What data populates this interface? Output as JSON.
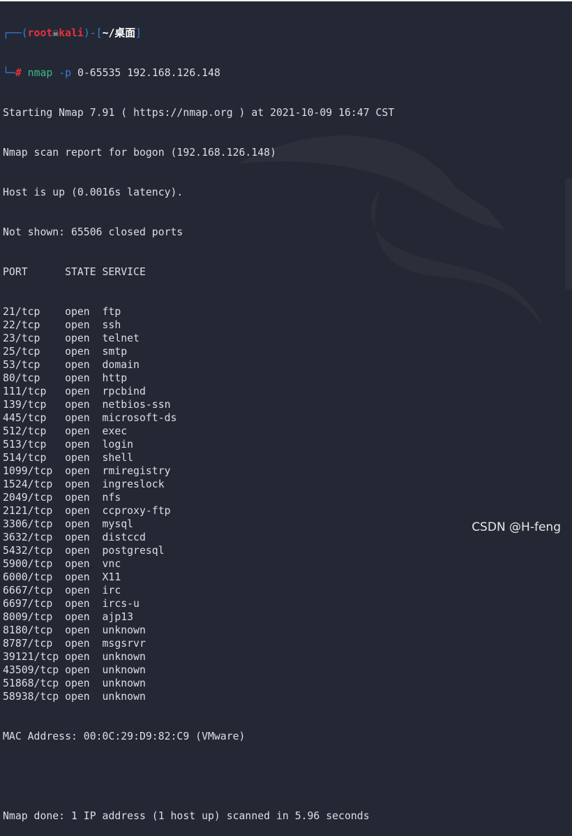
{
  "prompt": {
    "user": "root",
    "skull_icon": "skull-icon",
    "host": "kali",
    "cwd": "~/桌面",
    "symbol": "#",
    "command": "nmap",
    "option": "-p",
    "args": "0-65535 192.168.126.148"
  },
  "output": {
    "starting": "Starting Nmap 7.91 ( https://nmap.org ) at 2021-10-09 16:47 CST",
    "report": "Nmap scan report for bogon (192.168.126.148)",
    "host_up": "Host is up (0.0016s latency).",
    "not_shown": "Not shown: 65506 closed ports",
    "headers": {
      "port": "PORT",
      "state": "STATE",
      "service": "SERVICE"
    },
    "ports": [
      {
        "port": "21/tcp",
        "state": "open",
        "service": "ftp"
      },
      {
        "port": "22/tcp",
        "state": "open",
        "service": "ssh"
      },
      {
        "port": "23/tcp",
        "state": "open",
        "service": "telnet"
      },
      {
        "port": "25/tcp",
        "state": "open",
        "service": "smtp"
      },
      {
        "port": "53/tcp",
        "state": "open",
        "service": "domain"
      },
      {
        "port": "80/tcp",
        "state": "open",
        "service": "http"
      },
      {
        "port": "111/tcp",
        "state": "open",
        "service": "rpcbind"
      },
      {
        "port": "139/tcp",
        "state": "open",
        "service": "netbios-ssn"
      },
      {
        "port": "445/tcp",
        "state": "open",
        "service": "microsoft-ds"
      },
      {
        "port": "512/tcp",
        "state": "open",
        "service": "exec"
      },
      {
        "port": "513/tcp",
        "state": "open",
        "service": "login"
      },
      {
        "port": "514/tcp",
        "state": "open",
        "service": "shell"
      },
      {
        "port": "1099/tcp",
        "state": "open",
        "service": "rmiregistry"
      },
      {
        "port": "1524/tcp",
        "state": "open",
        "service": "ingreslock"
      },
      {
        "port": "2049/tcp",
        "state": "open",
        "service": "nfs"
      },
      {
        "port": "2121/tcp",
        "state": "open",
        "service": "ccproxy-ftp"
      },
      {
        "port": "3306/tcp",
        "state": "open",
        "service": "mysql"
      },
      {
        "port": "3632/tcp",
        "state": "open",
        "service": "distccd"
      },
      {
        "port": "5432/tcp",
        "state": "open",
        "service": "postgresql"
      },
      {
        "port": "5900/tcp",
        "state": "open",
        "service": "vnc"
      },
      {
        "port": "6000/tcp",
        "state": "open",
        "service": "X11"
      },
      {
        "port": "6667/tcp",
        "state": "open",
        "service": "irc"
      },
      {
        "port": "6697/tcp",
        "state": "open",
        "service": "ircs-u"
      },
      {
        "port": "8009/tcp",
        "state": "open",
        "service": "ajp13"
      },
      {
        "port": "8180/tcp",
        "state": "open",
        "service": "unknown"
      },
      {
        "port": "8787/tcp",
        "state": "open",
        "service": "msgsrvr"
      },
      {
        "port": "39121/tcp",
        "state": "open",
        "service": "unknown"
      },
      {
        "port": "43509/tcp",
        "state": "open",
        "service": "unknown"
      },
      {
        "port": "51868/tcp",
        "state": "open",
        "service": "unknown"
      },
      {
        "port": "58938/tcp",
        "state": "open",
        "service": "unknown"
      }
    ],
    "mac": "MAC Address: 00:0C:29:D9:82:C9 (VMware)",
    "done": "Nmap done: 1 IP address (1 host up) scanned in 5.96 seconds"
  },
  "watermark": "CSDN @H-feng",
  "colors": {
    "background": "#232834",
    "text": "#dcdfe4",
    "prompt_blue": "#3b7bd9",
    "prompt_red": "#e8313a",
    "command_green": "#3fb98c"
  }
}
